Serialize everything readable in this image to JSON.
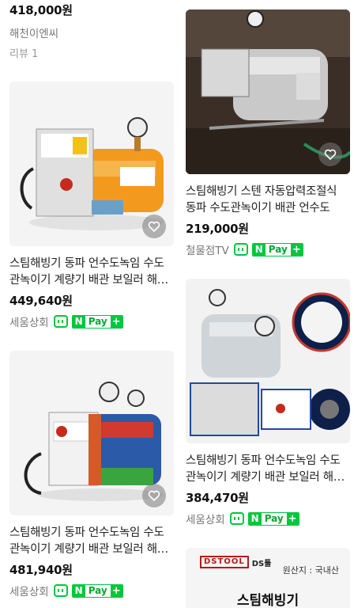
{
  "top_partial": {
    "price": "418,000원",
    "seller": "해천이엔씨",
    "review": "리뷰 1"
  },
  "left_cards": [
    {
      "title": "스팀해빙기 동파 언수도녹임 수도관녹이기 계량기 배관 보일러 해빙기",
      "price": "449,640원",
      "seller": "세움상회",
      "npay": "Pay"
    },
    {
      "title": "스팀해빙기 동파 언수도녹임 수도관녹이기 계량기 배관 보일러 해빙기",
      "price": "481,940원",
      "seller": "세움상회",
      "npay": "Pay"
    }
  ],
  "right_cards": [
    {
      "thumb_caption": "철물점TV",
      "title": "스팀해빙기 스텐 자동압력조절식 동파 수도관녹이기 배관 언수도",
      "price": "219,000원",
      "seller": "철물점TV",
      "npay": "Pay"
    },
    {
      "title": "스팀해빙기 동파 언수도녹임 수도관녹이기 계량기 배관 보일러 해빙기",
      "price": "384,470원",
      "seller": "세움상회",
      "npay": "Pay"
    }
  ],
  "ad_card": {
    "logo_box": "DSTOOL",
    "logo_text": "DS툴",
    "origin": "원산지 : 국내산",
    "title": "스팀해빙기"
  },
  "icons": {
    "wish": "heart-outline-icon",
    "talk": "talktalk-icon",
    "npay": "npay-plus-icon"
  },
  "colors": {
    "npay_green": "#00c73c",
    "price_text": "#111111",
    "seller_text": "#777777"
  }
}
